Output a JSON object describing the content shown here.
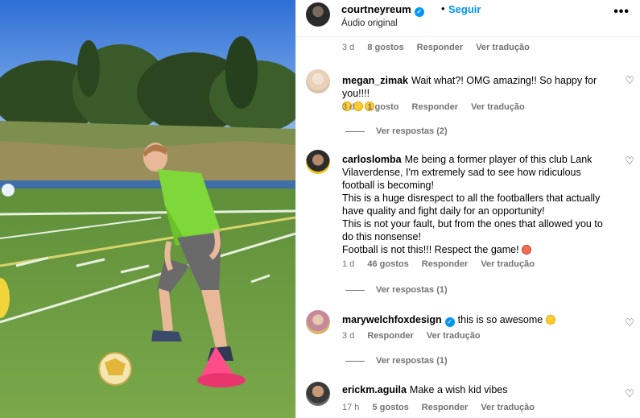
{
  "post": {
    "author": "courtneyreum",
    "follow_label": "Seguir",
    "separator": "•",
    "audio": "Áudio original",
    "more_label": "•••",
    "verified_mark": "✓",
    "heart_icon": "♡"
  },
  "first_meta": {
    "time": "3 d",
    "likes": "8 gostos",
    "reply": "Responder",
    "translate": "Ver tradução"
  },
  "comments": [
    {
      "user": "megan_zimak",
      "text": "Wait what?! OMG amazing!! So happy for you!!!!",
      "time": "3 d",
      "likes": "1 gosto",
      "reply": "Responder",
      "translate": "Ver tradução",
      "replies": "Ver respostas (2)"
    },
    {
      "user": "carloslomba",
      "text": "Me being a former player of this club Lank Vilaverdense, I'm extremely sad to see how ridiculous football is becoming!\nThis is a huge disrespect to all the footballers that actually have quality and fight daily for an opportunity!\nThis is not your fault, but from the ones that allowed you to do this nonsense!\nFootball is not this!!! Respect the game!",
      "time": "1 d",
      "likes": "46 gostos",
      "reply": "Responder",
      "translate": "Ver tradução",
      "replies": "Ver respostas (1)"
    },
    {
      "user": "marywelchfoxdesign",
      "text": "this is so awesome",
      "time": "3 d",
      "reply": "Responder",
      "translate": "Ver tradução",
      "replies": "Ver respostas (1)"
    },
    {
      "user": "erickm.aguila",
      "text": "Make a wish kid vibes",
      "time": "17 h",
      "likes": "5 gostos",
      "reply": "Responder",
      "translate": "Ver tradução"
    }
  ]
}
